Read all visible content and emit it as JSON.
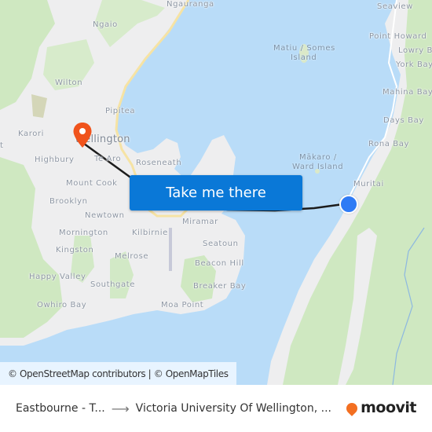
{
  "map": {
    "places": [
      {
        "id": "ngauranga",
        "label": "Ngauranga"
      },
      {
        "id": "ngaio",
        "label": "Ngaio"
      },
      {
        "id": "wilton",
        "label": "Wilton"
      },
      {
        "id": "pipitea",
        "label": "Pipitea"
      },
      {
        "id": "karori",
        "label": "Karori"
      },
      {
        "id": "wellington",
        "label": "Wellington"
      },
      {
        "id": "highbury",
        "label": "Highbury"
      },
      {
        "id": "te-aro",
        "label": "Te Aro"
      },
      {
        "id": "roseneath",
        "label": "Roseneath"
      },
      {
        "id": "mount-cook",
        "label": "Mount Cook"
      },
      {
        "id": "brooklyn",
        "label": "Brooklyn"
      },
      {
        "id": "newtown",
        "label": "Newtown"
      },
      {
        "id": "mornington",
        "label": "Mornington"
      },
      {
        "id": "kilbirnie",
        "label": "Kilbirnie"
      },
      {
        "id": "miramar",
        "label": "Miramar"
      },
      {
        "id": "kingston",
        "label": "Kingston"
      },
      {
        "id": "melrose",
        "label": "Melrose"
      },
      {
        "id": "seatoun",
        "label": "Seatoun"
      },
      {
        "id": "beacon-hill",
        "label": "Beacon Hill"
      },
      {
        "id": "happy-valley",
        "label": "Happy Valley"
      },
      {
        "id": "southgate",
        "label": "Southgate"
      },
      {
        "id": "breaker-bay",
        "label": "Breaker Bay"
      },
      {
        "id": "owhiro-bay",
        "label": "Owhiro Bay"
      },
      {
        "id": "moa-point",
        "label": "Moa Point"
      },
      {
        "id": "seaview",
        "label": "Seaview"
      },
      {
        "id": "point-howard",
        "label": "Point Howard"
      },
      {
        "id": "lowry-bay",
        "label": "Lowry Bay"
      },
      {
        "id": "york-bay",
        "label": "York Bay"
      },
      {
        "id": "matiu-somes",
        "label": "Matiu / Somes"
      },
      {
        "id": "island",
        "label": "Island"
      },
      {
        "id": "mahina-bay",
        "label": "Mahina Bay"
      },
      {
        "id": "days-bay",
        "label": "Days Bay"
      },
      {
        "id": "rona-bay",
        "label": "Rona Bay"
      },
      {
        "id": "makaro",
        "label": "Mākaro /"
      },
      {
        "id": "ward-island",
        "label": "Ward Island"
      },
      {
        "id": "muritai",
        "label": "Muritai"
      },
      {
        "id": "t-edge",
        "label": "t"
      }
    ],
    "destination_marker_color": "#f0531c",
    "origin_marker_color": "#2f7bf5",
    "route_color": "#1c1c1c"
  },
  "cta": {
    "label": "Take me there"
  },
  "attribution": "© OpenStreetMap contributors | © OpenMapTiles",
  "footer": {
    "origin": "Eastbourne - T...",
    "arrow": "⟶",
    "destination": "Victoria University Of Wellington, ...",
    "brand": "moovit",
    "brand_color": "#f36f21"
  }
}
